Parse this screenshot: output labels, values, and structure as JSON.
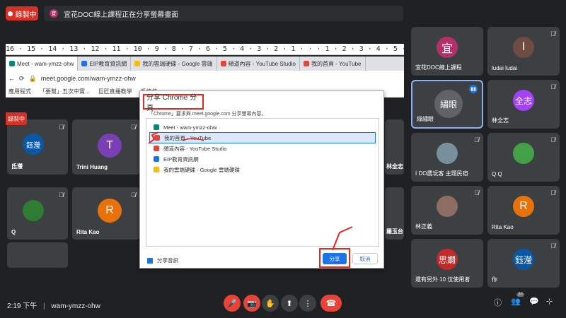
{
  "topbar": {
    "recording_label": "錄製中",
    "presenter_avatar_letter": "宜",
    "share_notice": "宜花DOC線上課程正在分享螢幕畫面"
  },
  "shared_screen": {
    "ruler_text": "16 · 15 · 14 · 13 · 12 · 11 · 10 · 9 · 8 · 7 · 6 · 5 · 4 · 3 · 2 · 1 · · · 1 · 2 · 3 · 4 · 5 · 6 · 7 · 8 · 9 · 10 · 11 · 12 · 13 · 14",
    "tabs": [
      {
        "label": "Meet - wam-ymzz-ohw",
        "color": "#00897b"
      },
      {
        "label": "EIP教育資訊網",
        "color": "#1a73e8"
      },
      {
        "label": "我的雲端硬碟 - Google 雲端",
        "color": "#fbbc04"
      },
      {
        "label": "頻道內容 - YouTube Studio",
        "color": "#ea4335"
      },
      {
        "label": "我的首頁 - YouTube",
        "color": "#ea4335"
      }
    ],
    "address": "meet.google.com/wam-ymzz-ohw",
    "bookmarks": [
      "應用程式",
      "「要幫」五次中實...",
      "巨匠直播教學",
      "系統技..."
    ],
    "inner_recording_label": "錄製中",
    "inner_tiles": [
      {
        "name": "氐瀅",
        "letter": "鈺瀅",
        "color": "#0b57a7"
      },
      {
        "name": "Trini Huang",
        "letter": "T",
        "color": "#7b3fb5"
      },
      {
        "name": "Q",
        "letter": "",
        "color": "#2e7d32"
      },
      {
        "name": "Rita Kao",
        "letter": "R",
        "color": "#e8710a"
      }
    ],
    "side_labels": [
      "林全志",
      "羅玉台"
    ]
  },
  "dialog": {
    "title": "分享 Chrome 分頁",
    "description": "「Chrome」要求與 meet.google.com 分享螢幕內容。",
    "items": [
      {
        "label": "Meet - wam-ymzz-ohw",
        "color": "#00897b",
        "selected": false
      },
      {
        "label": "我的首頁 - YouTube",
        "color": "#ea4335",
        "selected": true
      },
      {
        "label": "頻道內容 - YouTube Studio",
        "color": "#ea4335",
        "selected": false
      },
      {
        "label": "EIP教育資訊網",
        "color": "#1a73e8",
        "selected": false
      },
      {
        "label": "我的雲端硬碟 - Google 雲端硬碟",
        "color": "#fbbc04",
        "selected": false
      }
    ],
    "checkbox_label": "分享音訊",
    "share_button": "分享",
    "cancel_button": "取消"
  },
  "participants": [
    {
      "name": "宜花DOC線上課程",
      "letter": "宜",
      "color": "#b5306b",
      "muted": false
    },
    {
      "name": "ludai ludai",
      "letter": "l",
      "color": "#6d4c41",
      "muted": true
    },
    {
      "name": "綠繡眼",
      "letter": "繡眼",
      "color": "#5f6368",
      "muted": false,
      "speaking": true
    },
    {
      "name": "林全志",
      "letter": "全志",
      "color": "#a142f4",
      "muted": true
    },
    {
      "name": "I DO農玩客 主題民宿",
      "letter": "",
      "color": "#78909c",
      "muted": true
    },
    {
      "name": "Q Q",
      "letter": "",
      "color": "#43a047",
      "muted": true
    },
    {
      "name": "林正義",
      "letter": "",
      "color": "#8d6e63",
      "muted": true
    },
    {
      "name": "Rita Kao",
      "letter": "R",
      "color": "#e8710a",
      "muted": true
    },
    {
      "name": "還有另外 10 位使用者",
      "letter": "思嫺",
      "color": "#c62828",
      "muted": false
    },
    {
      "name": "你",
      "letter": "鈺瀅",
      "color": "#0b57a7",
      "muted": true
    }
  ],
  "bottombar": {
    "time": "2:19 下午",
    "meeting_code": "wam-ymzz-ohw",
    "participant_count": "20"
  }
}
